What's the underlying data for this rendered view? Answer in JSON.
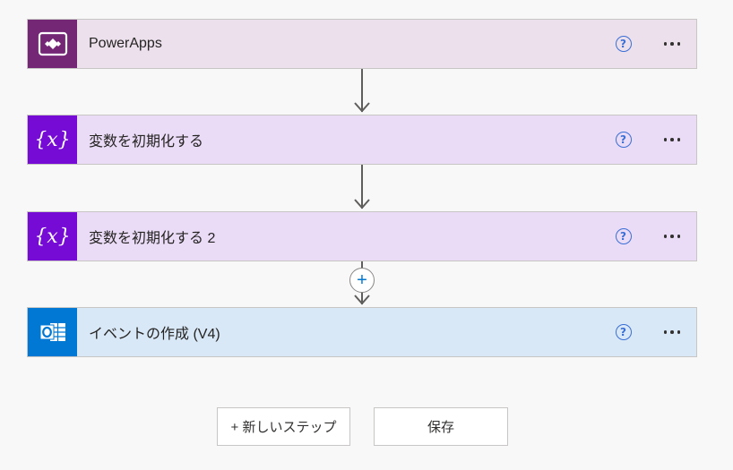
{
  "steps": [
    {
      "title": "PowerApps",
      "icon": "powerapps-icon",
      "color": "#742774",
      "bg": "#ebe0ec"
    },
    {
      "title": "変数を初期化する",
      "icon": "variable-icon",
      "color": "#770bd6",
      "bg": "#eadbf6"
    },
    {
      "title": "変数を初期化する 2",
      "icon": "variable-icon",
      "color": "#770bd6",
      "bg": "#eadbf6"
    },
    {
      "title": "イベントの作成 (V4)",
      "icon": "outlook-icon",
      "color": "#0078d4",
      "bg": "#d9e8f7"
    }
  ],
  "help_glyph": "?",
  "insert_glyph": "+",
  "variable_glyph": "{x}",
  "buttons": {
    "new_step": "+ 新しいステップ",
    "save": "保存"
  }
}
